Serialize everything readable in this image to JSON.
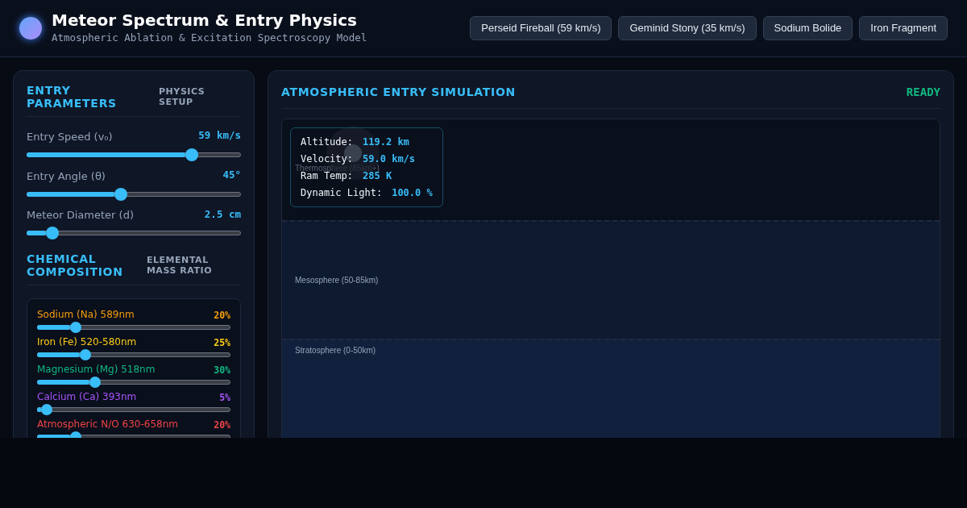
{
  "header": {
    "title": "Meteor Spectrum & Entry Physics",
    "subtitle": "Atmospheric Ablation & Excitation Spectroscopy Model"
  },
  "presets": [
    "Perseid Fireball (59 km/s)",
    "Geminid Stony (35 km/s)",
    "Sodium Bolide",
    "Iron Fragment"
  ],
  "entry_parameters": {
    "title": "ENTRY PARAMETERS",
    "tag": "PHYSICS SETUP",
    "sliders": [
      {
        "label": "Entry Speed (v₀)",
        "reading": "59 km/s",
        "level": 0.77
      },
      {
        "label": "Entry Angle (θ)",
        "reading": "45°",
        "level": 0.44
      },
      {
        "label": "Meteor Diameter (d)",
        "reading": "2.5 cm",
        "level": 0.12
      }
    ]
  },
  "composition": {
    "title": "CHEMICAL COMPOSITION",
    "tag": "ELEMENTAL MASS RATIO",
    "elements": [
      {
        "label": "Sodium (Na) 589nm",
        "reading": "20%",
        "level": 0.2,
        "color": "#f59e0b"
      },
      {
        "label": "Iron (Fe) 520-580nm",
        "reading": "25%",
        "level": 0.25,
        "color": "#facc15"
      },
      {
        "label": "Magnesium (Mg) 518nm",
        "reading": "30%",
        "level": 0.3,
        "color": "#10b981"
      },
      {
        "label": "Calcium (Ca) 393nm",
        "reading": "5%",
        "level": 0.05,
        "color": "#a855f7"
      },
      {
        "label": "Atmospheric N/O 630-658nm",
        "reading": "20%",
        "level": 0.2,
        "color": "#ef4444"
      }
    ]
  },
  "simulation": {
    "title": "ATMOSPHERIC ENTRY SIMULATION",
    "status": "READY",
    "layers": [
      {
        "label": "Thermosphere (85km+)"
      },
      {
        "label": "Mesosphere (50-85km)"
      },
      {
        "label": "Stratosphere (0-50km)"
      }
    ],
    "readouts": [
      {
        "label": "Altitude:",
        "value": "119.2 km"
      },
      {
        "label": "Velocity:",
        "value": "59.0 km/s"
      },
      {
        "label": "Ram Temp:",
        "value": "285 K"
      },
      {
        "label": "Dynamic Light:",
        "value": "100.0 %"
      }
    ]
  }
}
